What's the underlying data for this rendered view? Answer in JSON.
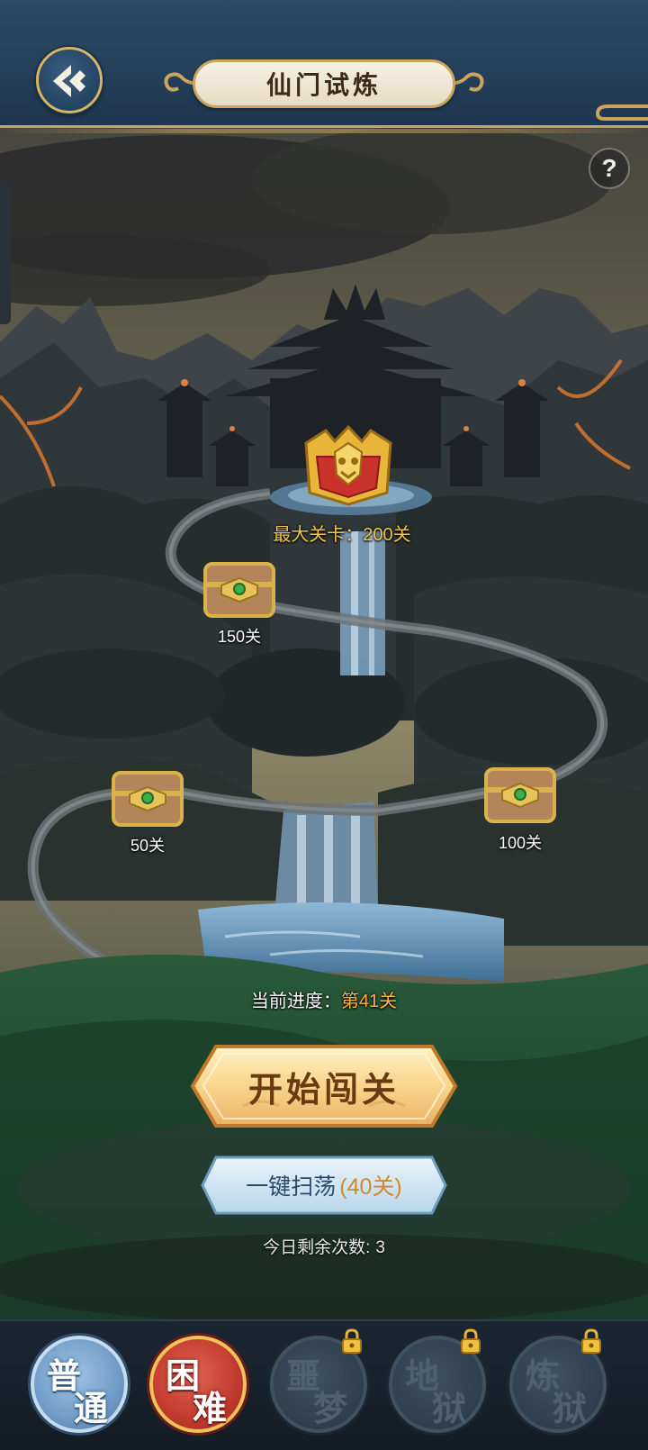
{
  "header": {
    "title": "仙门试炼",
    "back_icon": "back-arrow-icon",
    "help_label": "?"
  },
  "stage": {
    "max_label": "最大关卡：200关",
    "chests": [
      {
        "label": "150关",
        "icon": "treasure-chest-icon"
      },
      {
        "label": "50关",
        "icon": "treasure-chest-icon"
      },
      {
        "label": "100关",
        "icon": "treasure-chest-icon"
      }
    ],
    "final_chest_icon": "golden-treasure-chest-icon",
    "progress_prefix": "当前进度：",
    "progress_value": "第41关"
  },
  "actions": {
    "start_label": "开始闯关",
    "sweep_label": "一键扫荡",
    "sweep_count": "(40关)",
    "remaining_label": "今日剩余次数:",
    "remaining_value": "3"
  },
  "modes": [
    {
      "char1": "普",
      "char2": "通",
      "state": "available"
    },
    {
      "char1": "困",
      "char2": "难",
      "state": "selected"
    },
    {
      "char1": "噩",
      "char2": "梦",
      "state": "locked"
    },
    {
      "char1": "地",
      "char2": "狱",
      "state": "locked"
    },
    {
      "char1": "炼",
      "char2": "狱",
      "state": "locked"
    }
  ],
  "colors": {
    "gold": "#f3c64a",
    "progress_orange": "#ffb13b",
    "header_blue": "#2c4a66",
    "selected_red": "#c23a2e"
  }
}
